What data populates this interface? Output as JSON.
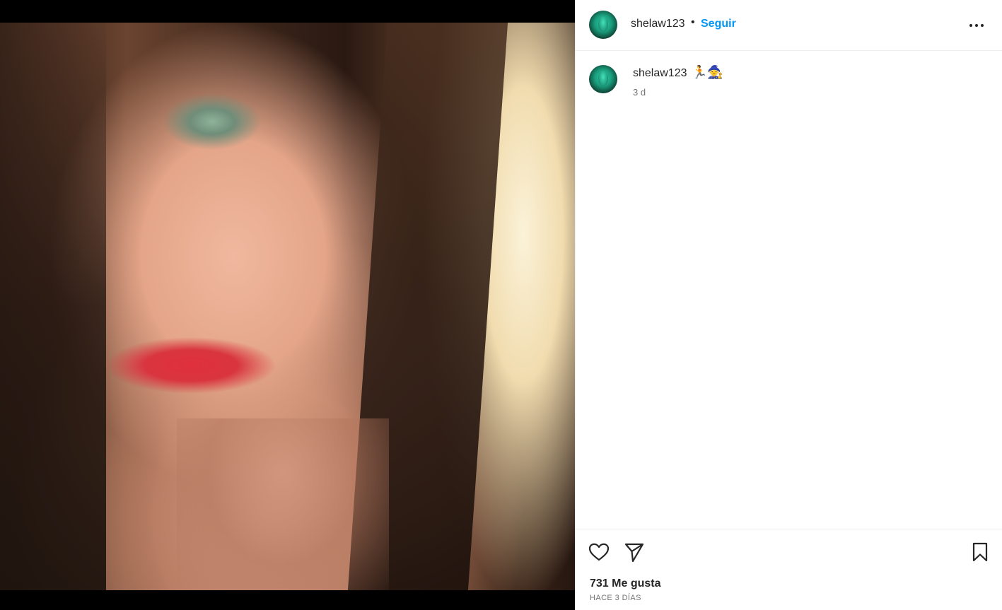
{
  "post": {
    "username": "shelaw123",
    "separator": "•",
    "follow_label": "Seguir",
    "more_icon": "more-horizontal-icon"
  },
  "caption": {
    "username": "shelaw123",
    "emojis": "🏃🧙",
    "time": "3 d"
  },
  "actions": {
    "like_icon": "heart-icon",
    "share_icon": "send-icon",
    "save_icon": "bookmark-icon"
  },
  "stats": {
    "likes": "731 Me gusta",
    "posted": "HACE 3 DÍAS"
  },
  "colors": {
    "link": "#0095f6",
    "text": "#262626",
    "muted": "#737373",
    "divider": "#efefef"
  }
}
